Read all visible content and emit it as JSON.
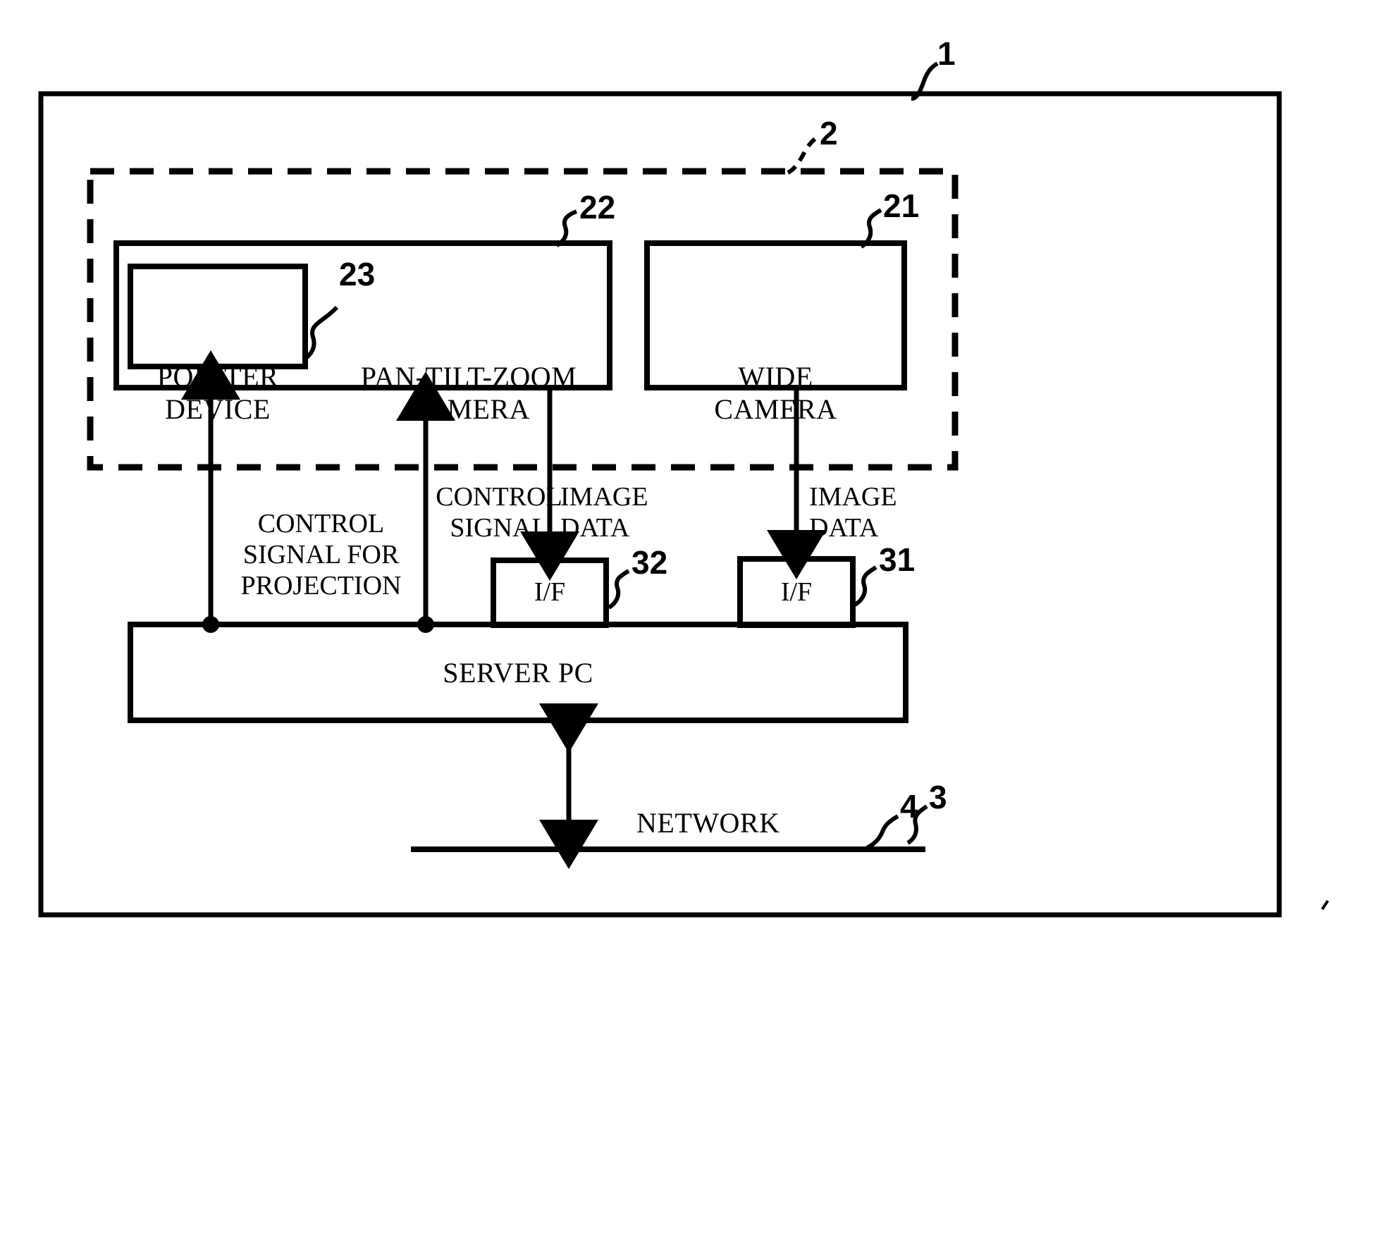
{
  "figure": {
    "type": "patent-block-diagram",
    "background_color": "#ffffff",
    "line_color": "#000000"
  },
  "blocks": {
    "outer_system": {
      "ref": "1",
      "border": "solid"
    },
    "camera_unit": {
      "ref": "2",
      "border": "dashed"
    },
    "pan_tilt_zoom_camera": {
      "label": "PAN-TILT-ZOOM\nCAMERA",
      "ref": "22"
    },
    "pointer_device": {
      "label": "POINTER\nDEVICE",
      "ref": "23"
    },
    "wide_camera": {
      "label": "WIDE\nCAMERA",
      "ref": "21"
    },
    "interface_left": {
      "label": "I/F",
      "ref": "32"
    },
    "interface_right": {
      "label": "I/F",
      "ref": "31"
    },
    "server_pc": {
      "label": "SERVER PC",
      "ref": "3"
    },
    "network": {
      "label": "NETWORK",
      "ref": "4"
    }
  },
  "signals": {
    "control_signal_for_projection": "CONTROL\nSIGNAL FOR\nPROJECTION",
    "control_signal": "CONTROL\nSIGNAL",
    "image_data_left": "IMAGE\nDATA",
    "image_data_right": "IMAGE\nDATA"
  },
  "reference_numerals": {
    "n1": "1",
    "n2": "2",
    "n3": "3",
    "n4": "4",
    "n21": "21",
    "n22": "22",
    "n23": "23",
    "n31": "31",
    "n32": "32"
  }
}
